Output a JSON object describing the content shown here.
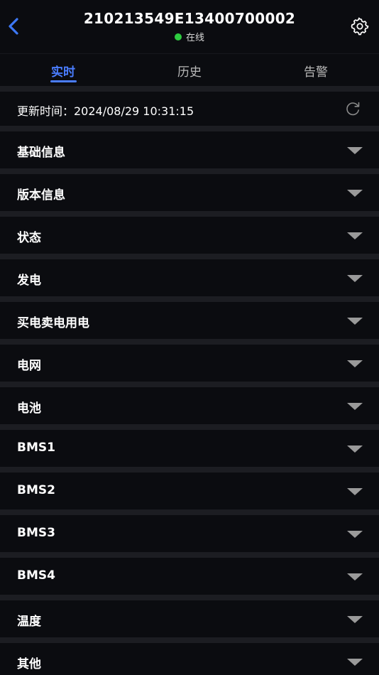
{
  "header": {
    "title": "210213549E13400700002",
    "status": "在线",
    "status_color": "#2ecc40",
    "back_icon": "chevron-left-icon",
    "settings_icon": "gear-icon"
  },
  "tabs": [
    {
      "label": "实时",
      "active": true
    },
    {
      "label": "历史",
      "active": false
    },
    {
      "label": "告警",
      "active": false
    }
  ],
  "accent_color": "#4a7dff",
  "update": {
    "label": "更新时间：2024/08/29 10:31:15",
    "refresh_icon": "refresh-icon"
  },
  "sections": [
    {
      "label": "基础信息"
    },
    {
      "label": "版本信息"
    },
    {
      "label": "状态"
    },
    {
      "label": "发电"
    },
    {
      "label": "买电卖电用电"
    },
    {
      "label": "电网"
    },
    {
      "label": "电池"
    },
    {
      "label": "BMS1"
    },
    {
      "label": "BMS2"
    },
    {
      "label": "BMS3"
    },
    {
      "label": "BMS4"
    },
    {
      "label": "温度"
    },
    {
      "label": "其他"
    }
  ]
}
